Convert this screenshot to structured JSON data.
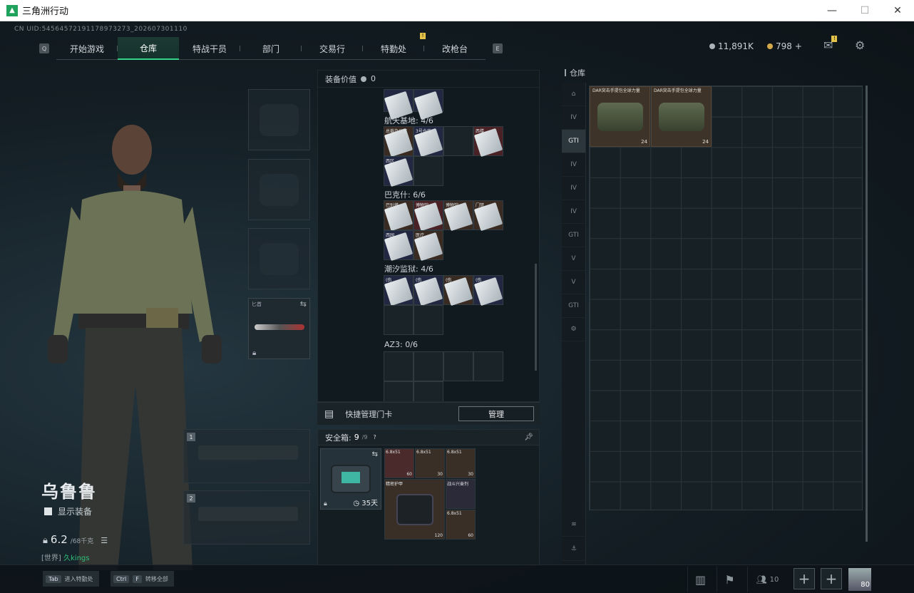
{
  "window": {
    "title": "三角洲行动",
    "minimize": "—",
    "maximize": "☐",
    "close": "✕"
  },
  "uid": "CN UID:54564572191178973273_202607301110",
  "nav": {
    "left_key": "Q",
    "right_key": "E",
    "tabs": [
      "开始游戏",
      "仓库",
      "特战干员",
      "部门",
      "交易行",
      "特勤处",
      "改枪台"
    ],
    "active": "仓库"
  },
  "currency": {
    "coins": "11,891K",
    "tokens": "798",
    "plus": "+"
  },
  "equip_value": {
    "label": "装备价值",
    "value": "0"
  },
  "sections": [
    {
      "label": "航天基地: 4/6"
    },
    {
      "label": "巴克什: 6/6"
    },
    {
      "label": "潮汐监狱: 4/6"
    },
    {
      "label": "AZ3: 0/6"
    }
  ],
  "card_labels": {
    "aerospace": [
      "总裁办公室",
      "3号仓库",
      "",
      "西楼",
      "西区"
    ],
    "baksh": [
      "巴别塔",
      "博物馆",
      "博物馆",
      "门禁",
      "西园",
      "医疗"
    ],
    "tidal": [
      "(伤",
      "(伤",
      "(伤",
      "(伤"
    ]
  },
  "quick_card": {
    "label": "快捷管理门卡",
    "button": "管理"
  },
  "safe_box": {
    "label": "安全箱:",
    "count": "9",
    "of": "/9",
    "help": "?",
    "days": "35天",
    "items": [
      {
        "label": "6.8x51",
        "count": "60"
      },
      {
        "label": "6.8x51",
        "count": "30"
      },
      {
        "label": "6.8x51",
        "count": "30"
      },
      {
        "label": "精密护甲",
        "count": "120"
      },
      {
        "label": "战斗兴奋剂",
        "count": ""
      },
      {
        "label": "6.8x51",
        "count": "60"
      }
    ]
  },
  "character": {
    "name": "乌鲁鲁",
    "show_equipment": "显示装备",
    "weight": "6.2",
    "weight_max": "/68千克",
    "world_tag": "[世界]",
    "world_user": "久kings"
  },
  "knife": {
    "label": "匕首"
  },
  "weapon_slots": [
    "1",
    "2"
  ],
  "warehouse": {
    "title": "仓库",
    "items": [
      {
        "label": "DAR突击手提包全球力量",
        "count": "24"
      },
      {
        "label": "DAR突击手提包全球力量",
        "count": "24"
      }
    ],
    "side_tabs": [
      "⌂",
      "IV",
      "GTI",
      "IV",
      "IV",
      "IV",
      "GTI",
      "V",
      "V",
      "GTI",
      "⚙"
    ]
  },
  "bottom": {
    "tab_key": "Tab",
    "tab_text": "进入特勤处",
    "ctrl_key": "Ctrl",
    "f_key": "F",
    "ctrl_text": "转移全部",
    "friends": "10",
    "avatar_level": "80"
  }
}
